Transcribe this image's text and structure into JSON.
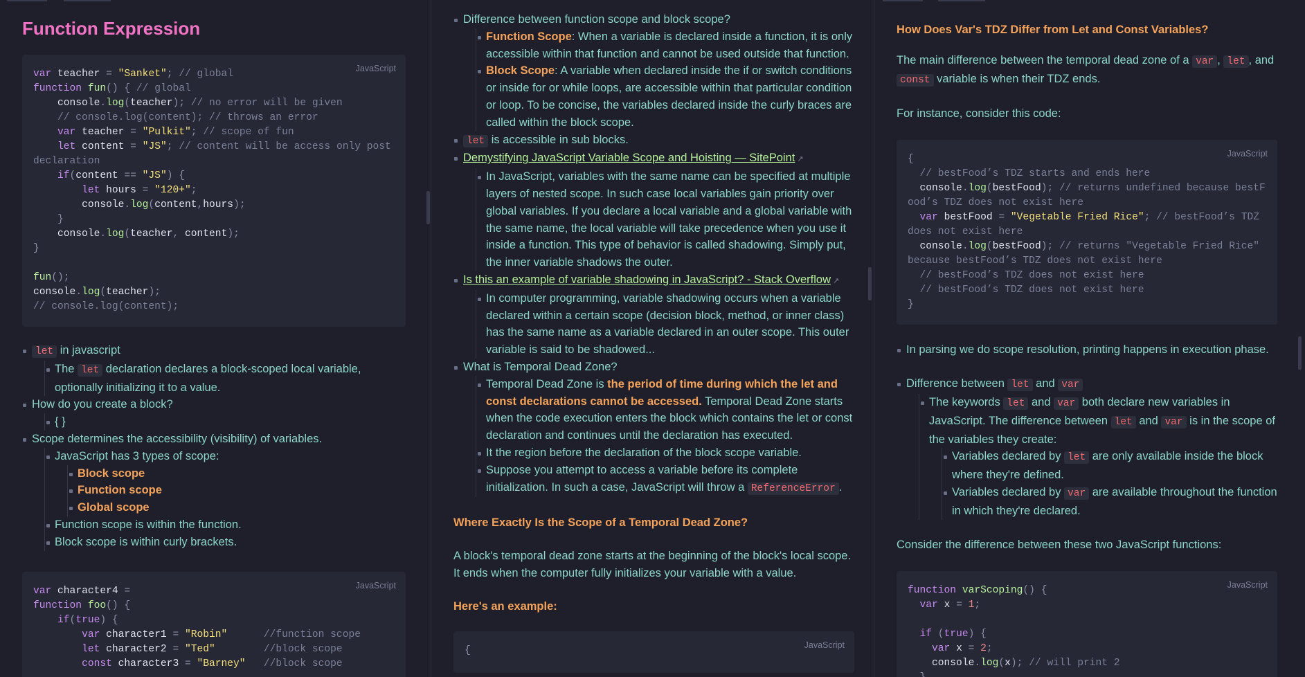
{
  "pane1": {
    "title": "Function Expression",
    "code1_lang": "JavaScript",
    "list": {
      "let_code": "let",
      "let_text": " in javascript",
      "let_sub_pre": "The ",
      "let_sub_code": "let",
      "let_sub_post": " declaration declares a block-scoped local variable, optionally initializing it to a value.",
      "block_q": "How do you create a block?",
      "block_a": "{ }",
      "scope_text": "Scope determines the accessibility (visibility) of variables.",
      "types_text": "JavaScript has 3 types of scope:",
      "type1": "Block scope",
      "type2": "Function scope",
      "type3": "Global scope",
      "fn_scope": "Function scope is within the function.",
      "block_scope": "Block scope is within curly brackets."
    },
    "code2_lang": "JavaScript"
  },
  "pane2": {
    "q1": "Difference between function scope and block scope?",
    "fs_label": "Function Scope",
    "fs_text": ": When a variable is declared inside a function, it is only accessible within that function and cannot be used outside that function.",
    "bs_label": "Block Scope",
    "bs_text": ": A variable when declared inside the if or switch conditions or inside for or while loops, are accessible within that particular condition or loop. To be concise, the variables declared inside the curly braces are called within the block scope.",
    "let_code": "let",
    "let_text": " is accessible in sub blocks.",
    "link1": "Demystifying JavaScript Variable Scope and Hoisting — SitePoint",
    "link1_text": "In JavaScript, variables with the same name can be specified at multiple layers of nested scope. In such case local variables gain priority over global variables. If you declare a local variable and a global variable with the same name, the local variable will take precedence when you use it inside a function. This type of behavior is called shadowing. Simply put, the inner variable shadows the outer.",
    "link2": "Is this an example of variable shadowing in JavaScript? - Stack Overflow",
    "link2_text": "In computer programming, variable shadowing occurs when a variable declared within a certain scope (decision block, method, or inner class) has the same name as a variable declared in an outer scope. This outer variable is said to be shadowed...",
    "tdz_q": "What is Temporal Dead Zone?",
    "tdz_pre": "Temporal Dead Zone is ",
    "tdz_bold": "the period of time during which the let and const declarations cannot be accessed.",
    "tdz_post": " Temporal Dead Zone starts when the code execution enters the block which contains the let or const declaration and continues until the declaration has executed.",
    "tdz_region": "It the region before the declaration of the block scope variable.",
    "tdz_suppose": "Suppose you attempt to access a variable before its complete initialization. In such a case, JavaScript will throw a ",
    "tdz_error": "ReferenceError",
    "tdz_end": ".",
    "h_where": "Where Exactly Is the Scope of a Temporal Dead Zone?",
    "where_text": "A block's temporal dead zone starts at the beginning of the block's local scope. It ends when the computer fully initializes your variable with a value.",
    "h_example": "Here's an example:",
    "code_lang": "JavaScript",
    "code_first": "{"
  },
  "pane3": {
    "h_var": "How Does Var's TDZ Differ from Let and Const Variables?",
    "main_pre": "The main difference between the temporal dead zone of a ",
    "c_var": "var",
    "c_let": "let",
    "main_and": ", and",
    "c_const": "const",
    "main_post": " variable is when their TDZ ends.",
    "instance": "For instance, consider this code:",
    "code1_lang": "JavaScript",
    "parsing": "In parsing we do scope resolution, printing happens in execution phase.",
    "diff_pre": "Difference between ",
    "diff_and": " and ",
    "kw_pre": "The keywords ",
    "kw_mid": " and ",
    "kw_post": " both declare new variables in JavaScript. The difference between ",
    "kw_post2": " and ",
    "kw_post3": " is in the scope of the variables they create:",
    "let_avail_pre": "Variables declared by ",
    "let_avail_post": " are only available inside the block where they're defined.",
    "var_avail_pre": "Variables declared by ",
    "var_avail_post": " are available throughout the function in which they're declared.",
    "consider": "Consider the difference between these two JavaScript functions:",
    "code2_lang": "JavaScript"
  },
  "colors": {
    "background": "#1e1f2b",
    "code_background": "#262836",
    "heading_pink": "#f073c4",
    "text_teal": "#8bd5ca",
    "accent_orange": "#f5a35a",
    "link_green": "#b6f09a",
    "inline_code_red": "#f0696e"
  }
}
